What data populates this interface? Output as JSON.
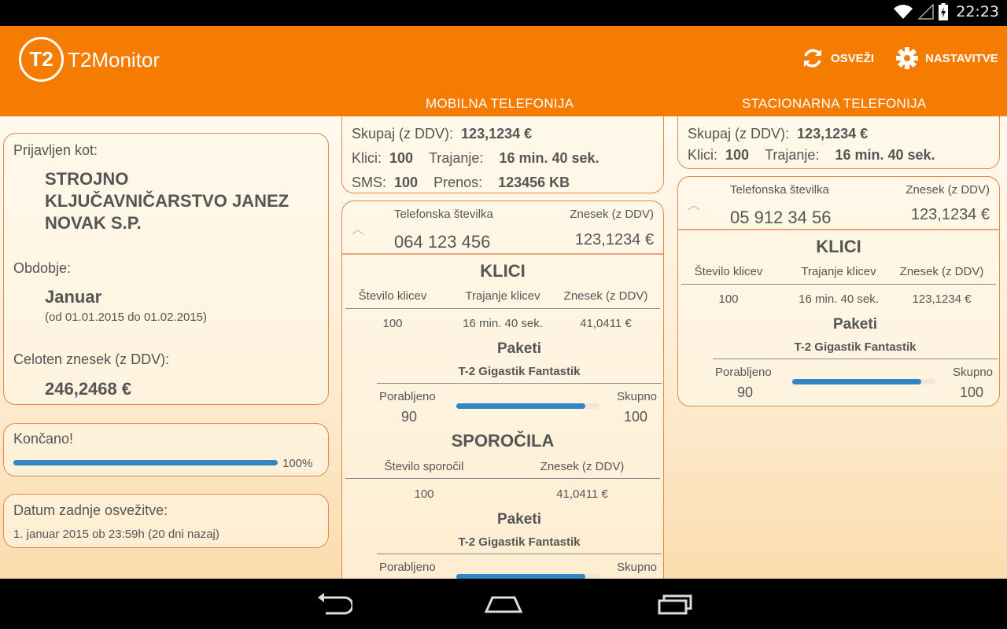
{
  "status": {
    "time": "22:23"
  },
  "app": {
    "logo_text": "T2",
    "title": "T2Monitor"
  },
  "actions": {
    "refresh": "OSVEŽI",
    "settings": "NASTAVITVE"
  },
  "tabs": {
    "mobile": "MOBILNA TELEFONIJA",
    "fixed": "STACIONARNA TELEFONIJA"
  },
  "account": {
    "logged_label": "Prijavljen kot:",
    "company": "STROJNO KLJUČAVNIČARSTVO JANEZ NOVAK S.P.",
    "period_label": "Obdobje:",
    "month": "Januar",
    "range": "(od  01.01.2015  do  01.02.2015)",
    "total_label": "Celoten znesek (z DDV):",
    "total": "246,2468 €"
  },
  "sync": {
    "status": "Končano!",
    "progress_percent": 100,
    "progress_text": "100%",
    "last_label": "Datum zadnje osvežitve:",
    "last_value": "1. januar 2015 ob 23:59h (20 dni nazaj)"
  },
  "mobile": {
    "summary": {
      "total_label": "Skupaj (z DDV):",
      "total": "123,1234 €",
      "calls_label": "Klici:",
      "calls": "100",
      "duration_label": "Trajanje:",
      "duration": "16 min. 40 sek.",
      "sms_label": "SMS:",
      "sms": "100",
      "transfer_label": "Prenos:",
      "transfer": "123456 KB"
    },
    "detail": {
      "phone_label": "Telefonska številka",
      "phone": "064 123 456",
      "amount_label": "Znesek (z DDV)",
      "amount": "123,1234 €",
      "calls_title": "KLICI",
      "calls_headers": [
        "Število klicev",
        "Trajanje klicev",
        "Znesek (z DDV)"
      ],
      "calls_row": [
        "100",
        "16 min. 40 sek.",
        "41,0411 €"
      ],
      "pkg_title": "Paketi",
      "pkg_name": "T-2 Gigastik Fantastik",
      "used_label": "Porabljeno",
      "used": "90",
      "total_label": "Skupno",
      "total": "100",
      "usage_fraction": 0.9,
      "sms_title": "SPOROČILA",
      "sms_headers": [
        "Število sporočil",
        "Znesek (z DDV)"
      ],
      "sms_row": [
        "100",
        "41,0411 €"
      ],
      "pkg2_title": "Paketi",
      "pkg2_name": "T-2 Gigastik Fantastik",
      "used2_label": "Porabljeno",
      "total2_label": "Skupno"
    }
  },
  "fixed": {
    "summary": {
      "total_label": "Skupaj (z DDV):",
      "total": "123,1234 €",
      "calls_label": "Klici:",
      "calls": "100",
      "duration_label": "Trajanje:",
      "duration": "16 min. 40 sek."
    },
    "detail": {
      "phone_label": "Telefonska številka",
      "phone": "05 912 34 56",
      "amount_label": "Znesek (z DDV)",
      "amount": "123,1234 €",
      "calls_title": "KLICI",
      "calls_headers": [
        "Število klicev",
        "Trajanje klicev",
        "Znesek (z DDV)"
      ],
      "calls_row": [
        "100",
        "16 min. 40 sek.",
        "123,1234 €"
      ],
      "pkg_title": "Paketi",
      "pkg_name": "T-2 Gigastik Fantastik",
      "used_label": "Porabljeno",
      "used": "90",
      "total_label": "Skupno",
      "total": "100",
      "usage_fraction": 0.9
    }
  }
}
